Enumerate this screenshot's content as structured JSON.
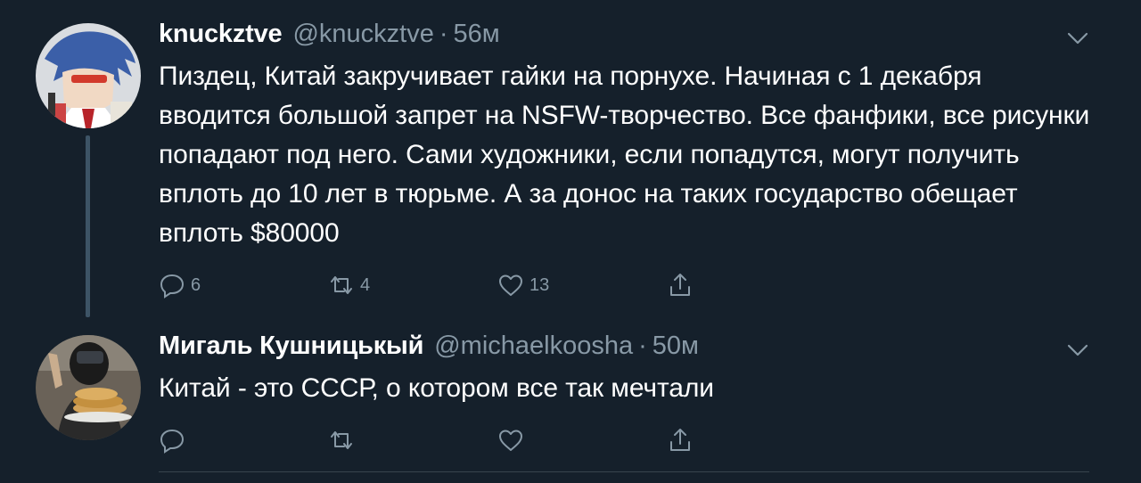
{
  "tweets": [
    {
      "name": "knuckztve",
      "handle": "@knuckztve",
      "dot": "·",
      "time": "56м",
      "text": "Пиздец, Китай закручивает гайки на порнухе. Начиная с 1 декабря вводится большой запрет на NSFW-творчество. Все фанфики, все рисунки попадают под него. Сами художники, если попадутся, могут получить вплоть до 10 лет в тюрьме. А за донос на таких государство обещает вплоть $80000",
      "replies": "6",
      "retweets": "4",
      "likes": "13",
      "avatar_icon": "anime-character-avatar"
    },
    {
      "name": "Мигаль Кушницькый",
      "handle": "@michaelkoosha",
      "dot": "·",
      "time": "50м",
      "text": "Китай - это СССР, о котором все так мечтали",
      "replies": "",
      "retweets": "",
      "likes": "",
      "avatar_icon": "person-with-pancakes-avatar"
    }
  ],
  "icons": {
    "reply": "reply-icon",
    "retweet": "retweet-icon",
    "like": "like-icon",
    "share": "share-icon",
    "more": "chevron-down-icon"
  },
  "colors": {
    "background": "#15202b",
    "secondary_text": "#8899a6",
    "thread_line": "#3d5466"
  }
}
